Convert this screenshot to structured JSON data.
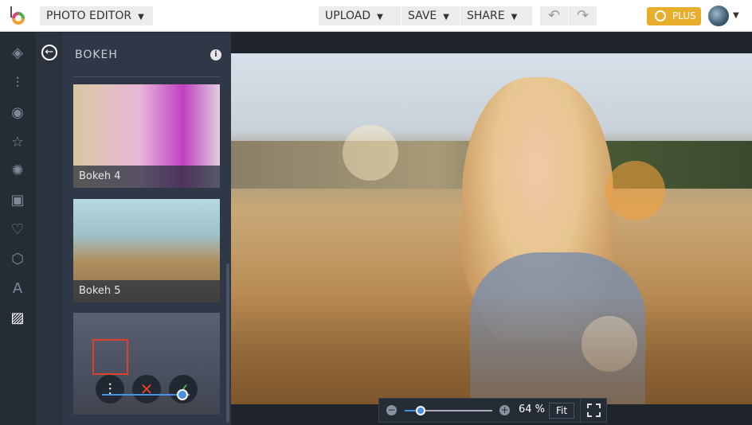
{
  "header": {
    "app_menu": "PHOTO EDITOR",
    "upload": "UPLOAD",
    "save": "SAVE",
    "share": "SHARE",
    "plus": "PLUS"
  },
  "panel": {
    "title": "BOKEH",
    "info": "i",
    "thumbnails": [
      {
        "label": "Bokeh 4"
      },
      {
        "label": "Bokeh 5"
      }
    ],
    "intensity_percent": 92
  },
  "zoom": {
    "value": "64 %",
    "fit": "Fit",
    "level_percent": 18
  },
  "colors": {
    "accent": "#e8ad2b",
    "highlight": "#e0402a",
    "slider": "#4a90e2"
  }
}
